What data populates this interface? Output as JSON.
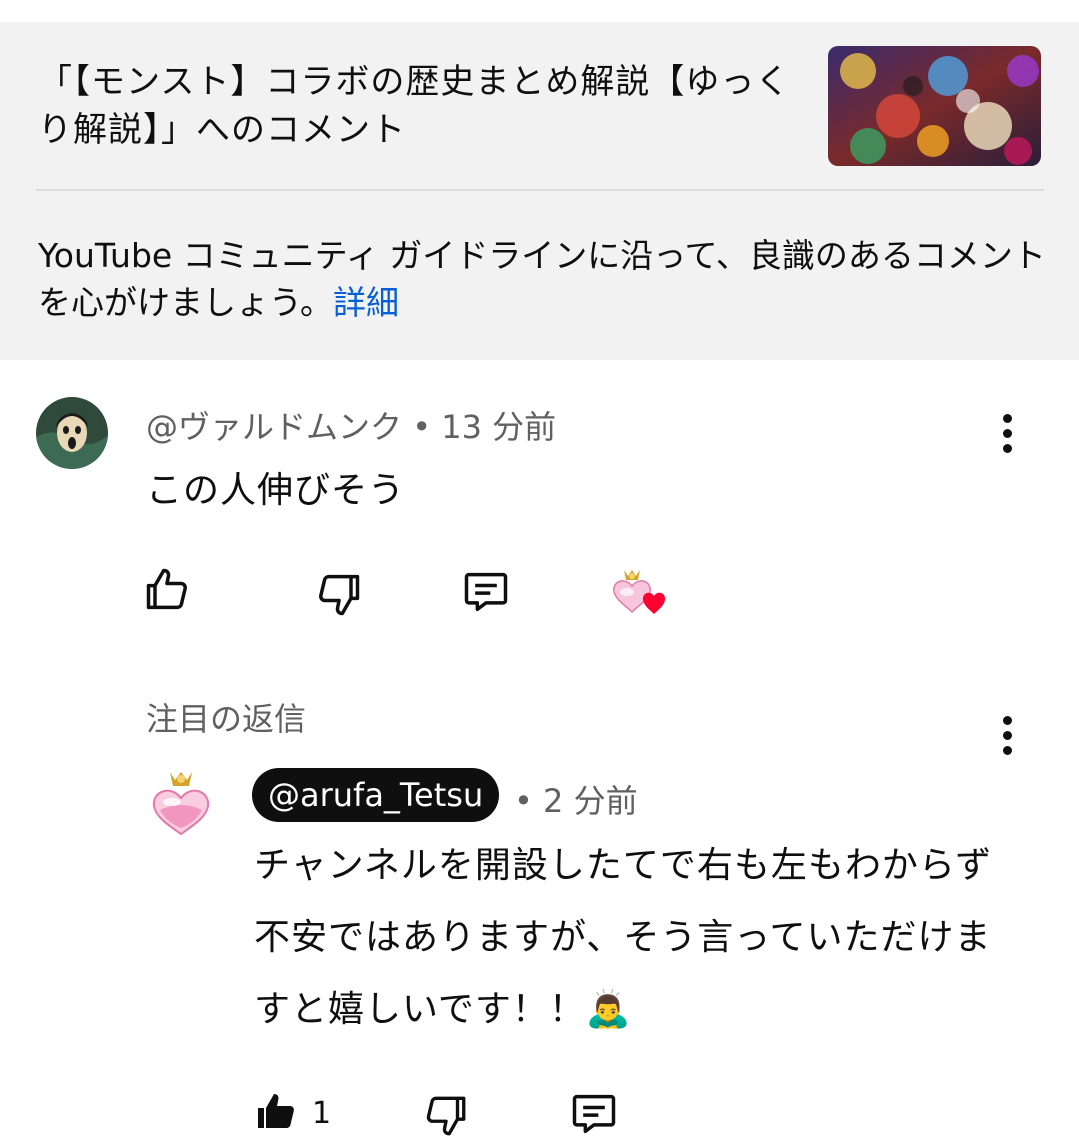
{
  "header": {
    "video_title": "「【モンスト】コラボの歴史まとめ解説【ゆっくり解説】」へのコメント",
    "guideline_text": "YouTube コミュニティ ガイドラインに沿って、良識のあるコメントを心がけましょう。",
    "guideline_link": "詳細"
  },
  "comment": {
    "author": "@ヴァルドムンク",
    "time": "13 分前",
    "separator": "•",
    "body": "この人伸びそう",
    "actions": {
      "reply_label": "",
      "creator_heart": true
    }
  },
  "replies": {
    "section_label": "注目の返信",
    "items": [
      {
        "author": "@arufa_Tetsu",
        "time": "2 分前",
        "separator": "•",
        "body": "チャンネルを開設したてで右も左もわからず不安ではありますが、そう言っていただけますと嬉しいです！！🙇‍♂️",
        "like_count": "1"
      }
    ]
  },
  "colors": {
    "link": "#065fd4",
    "heart": "#ff0033",
    "chip_bg": "#0f0f0f"
  }
}
